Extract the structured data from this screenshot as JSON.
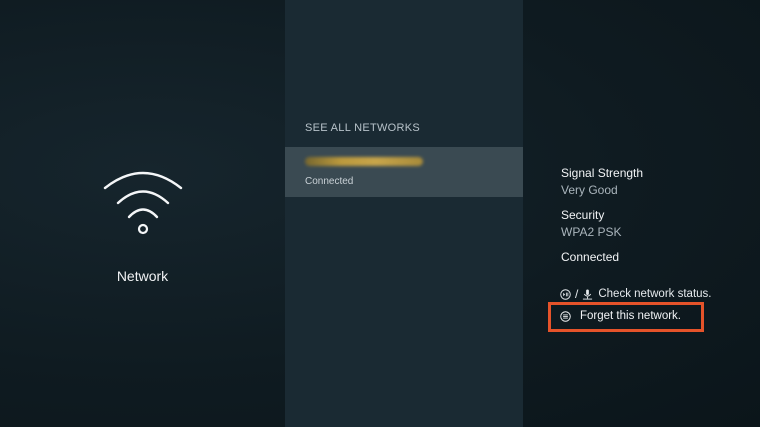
{
  "left": {
    "icon": "wifi-icon",
    "label": "Network"
  },
  "networks": {
    "header": "SEE ALL NETWORKS",
    "items": [
      {
        "name": "",
        "status": "Connected",
        "selected": true
      }
    ]
  },
  "details": {
    "signal_label": "Signal Strength",
    "signal_value": "Very Good",
    "security_label": "Security",
    "security_value": "WPA2 PSK",
    "connection_status": "Connected"
  },
  "hints": {
    "check_status": {
      "icons": [
        "play-pause-icon",
        "microphone-icon"
      ],
      "separator": "/",
      "text": "Check network status."
    },
    "forget": {
      "icon": "menu-icon",
      "text": "Forget this network.",
      "highlight_color": "#e5532a"
    }
  },
  "colors": {
    "background": "#0f1a20",
    "panel": "#1a2a33",
    "selected_row": "#3a4a52"
  }
}
